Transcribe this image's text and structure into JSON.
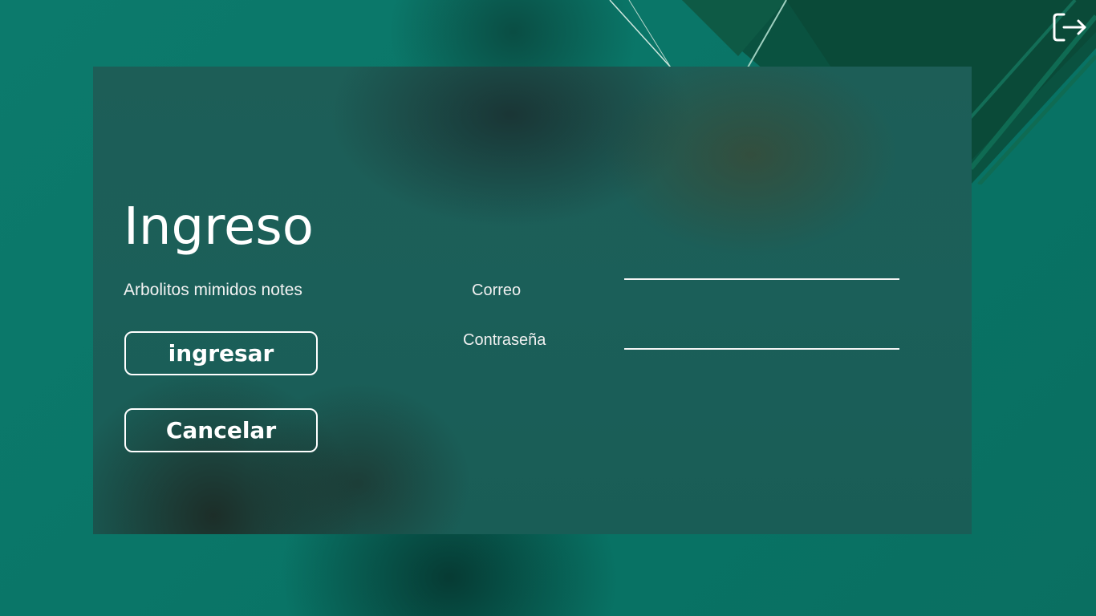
{
  "login": {
    "title": "Ingreso",
    "subtitle": "Arbolitos mimidos notes",
    "ingresar_label": "ingresar",
    "cancelar_label": "Cancelar"
  },
  "form": {
    "correo_label": "Correo",
    "contrasena_label": "Contraseña",
    "correo_value": "",
    "contrasena_value": ""
  },
  "icons": {
    "exit": "logout-icon"
  },
  "colors": {
    "background": "#0a7668",
    "card": "#1b5f59",
    "text": "#ffffff"
  }
}
